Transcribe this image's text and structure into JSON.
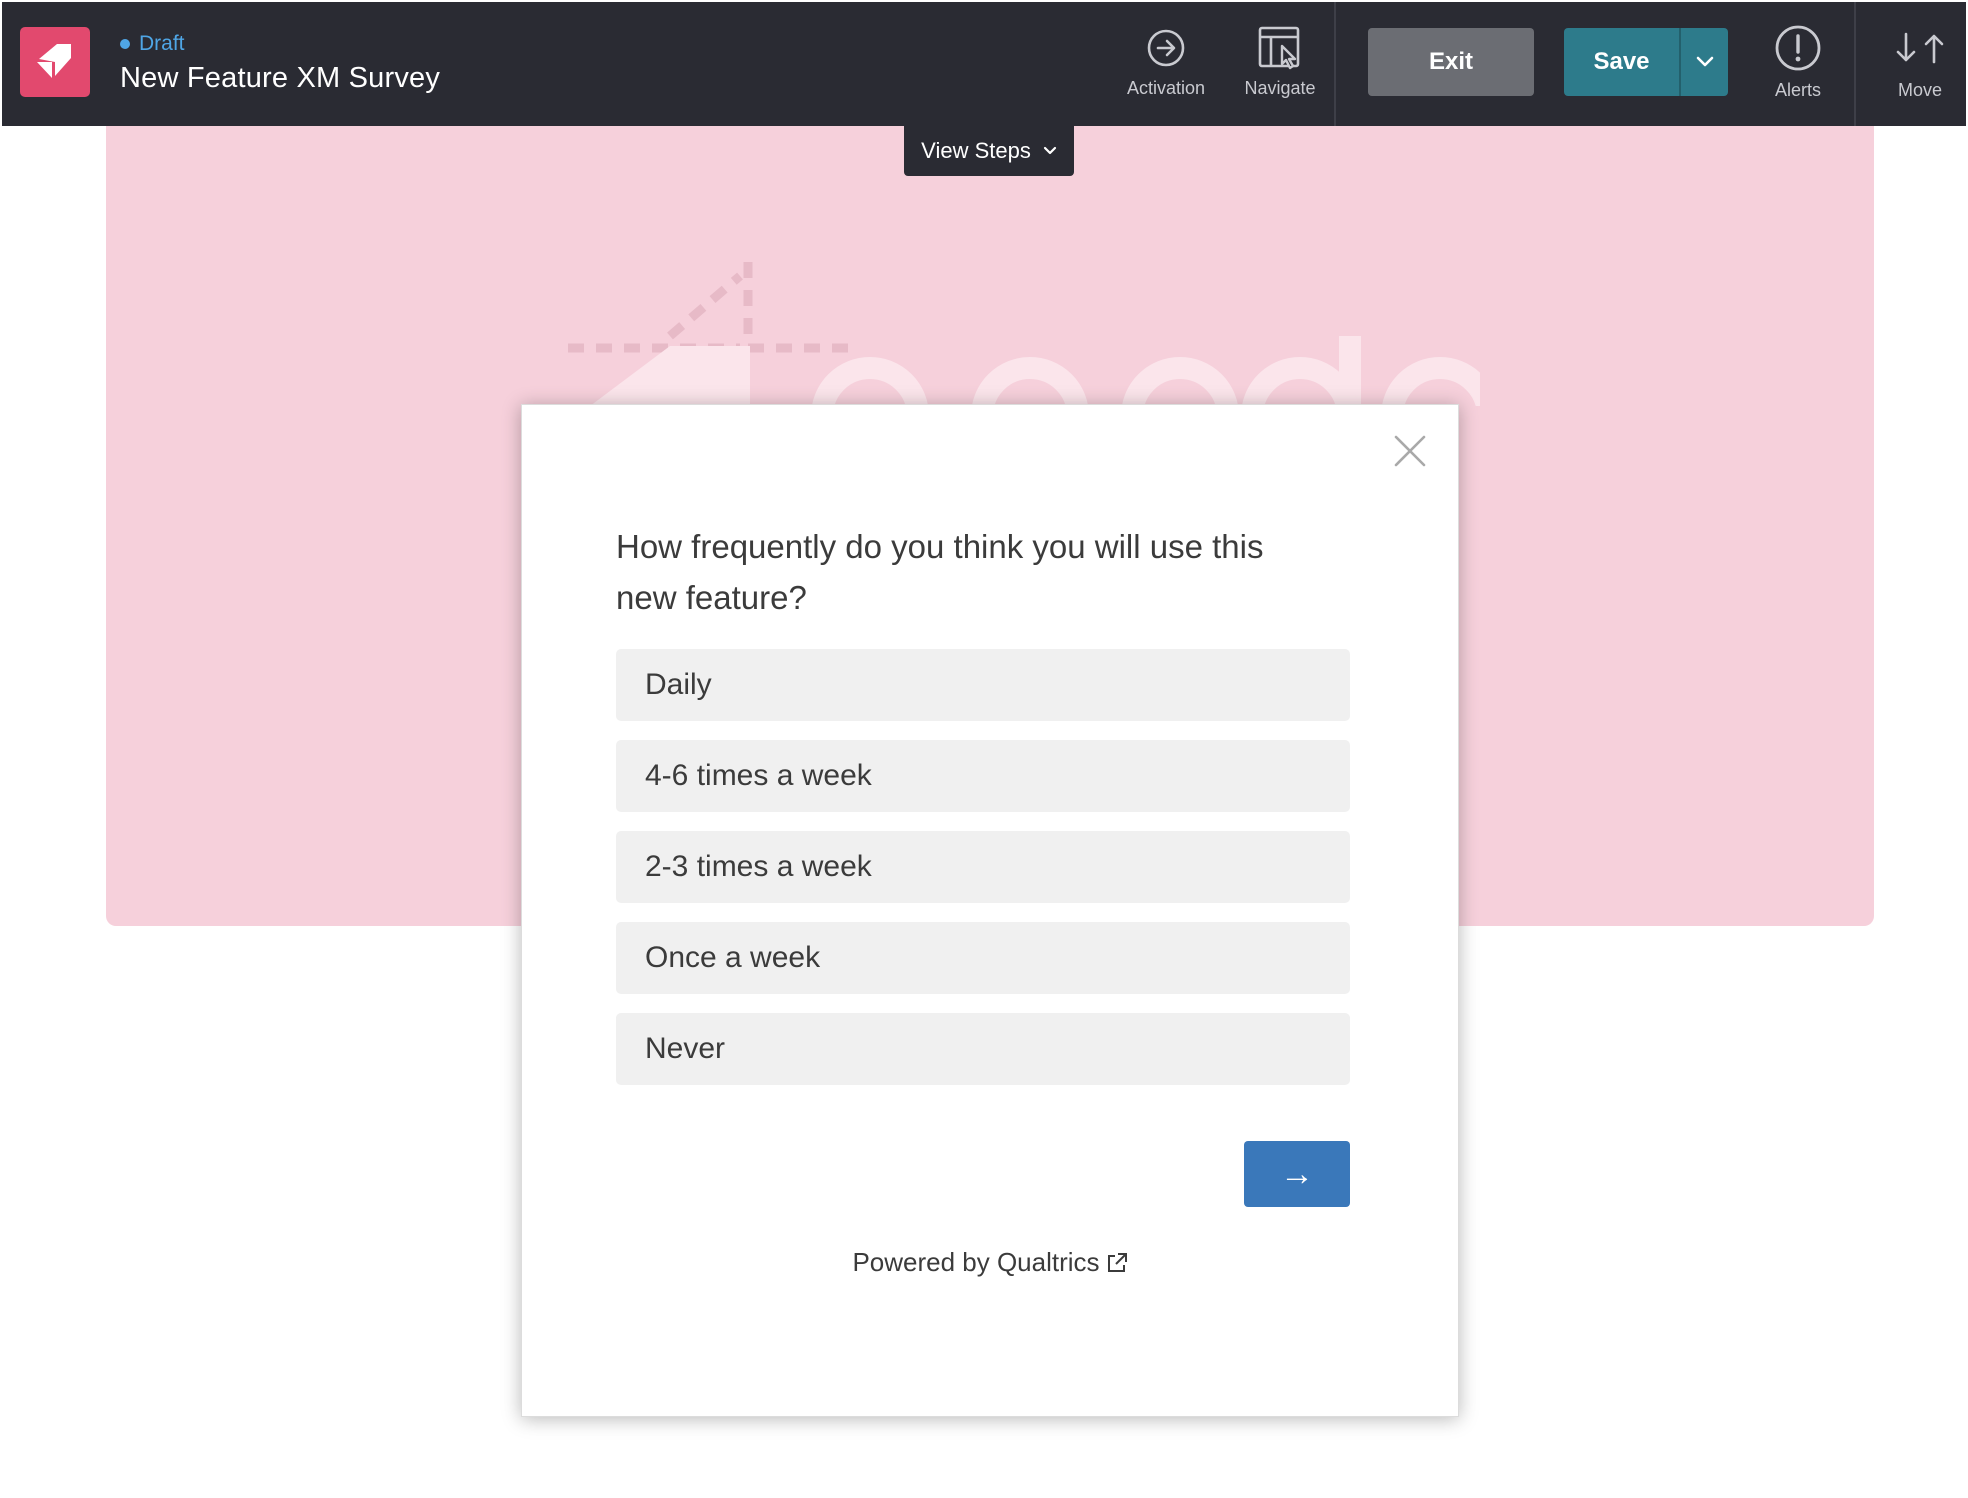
{
  "header": {
    "status": "Draft",
    "title": "New Feature XM Survey",
    "tools": {
      "activation": "Activation",
      "navigate": "Navigate",
      "alerts": "Alerts",
      "move": "Move"
    },
    "exit_label": "Exit",
    "save_label": "Save"
  },
  "colors": {
    "toolbar_bg": "#2a2b33",
    "brand": "#e2496e",
    "draft": "#4fa6e6",
    "save": "#2d7b8b",
    "exit": "#6b6d73",
    "canvas": "#f6d0db",
    "next": "#3a78ba"
  },
  "canvas": {
    "view_steps_label": "View Steps"
  },
  "survey": {
    "question": "How frequently do you think you will use this new feature?",
    "options": [
      {
        "label": "Daily"
      },
      {
        "label": "4-6 times a week"
      },
      {
        "label": "2-3 times a week"
      },
      {
        "label": "Once a week"
      },
      {
        "label": "Never"
      }
    ],
    "next_label": "→",
    "powered_by": "Powered by Qualtrics"
  },
  "icons": {
    "logo": "pendo-logo-icon",
    "activation": "arrow-circle-right-icon",
    "navigate": "layout-cursor-icon",
    "save_menu": "chevron-down-icon",
    "alerts": "exclamation-circle-icon",
    "move": "arrow-up-down-icon",
    "close": "close-icon",
    "external": "external-link-icon"
  }
}
